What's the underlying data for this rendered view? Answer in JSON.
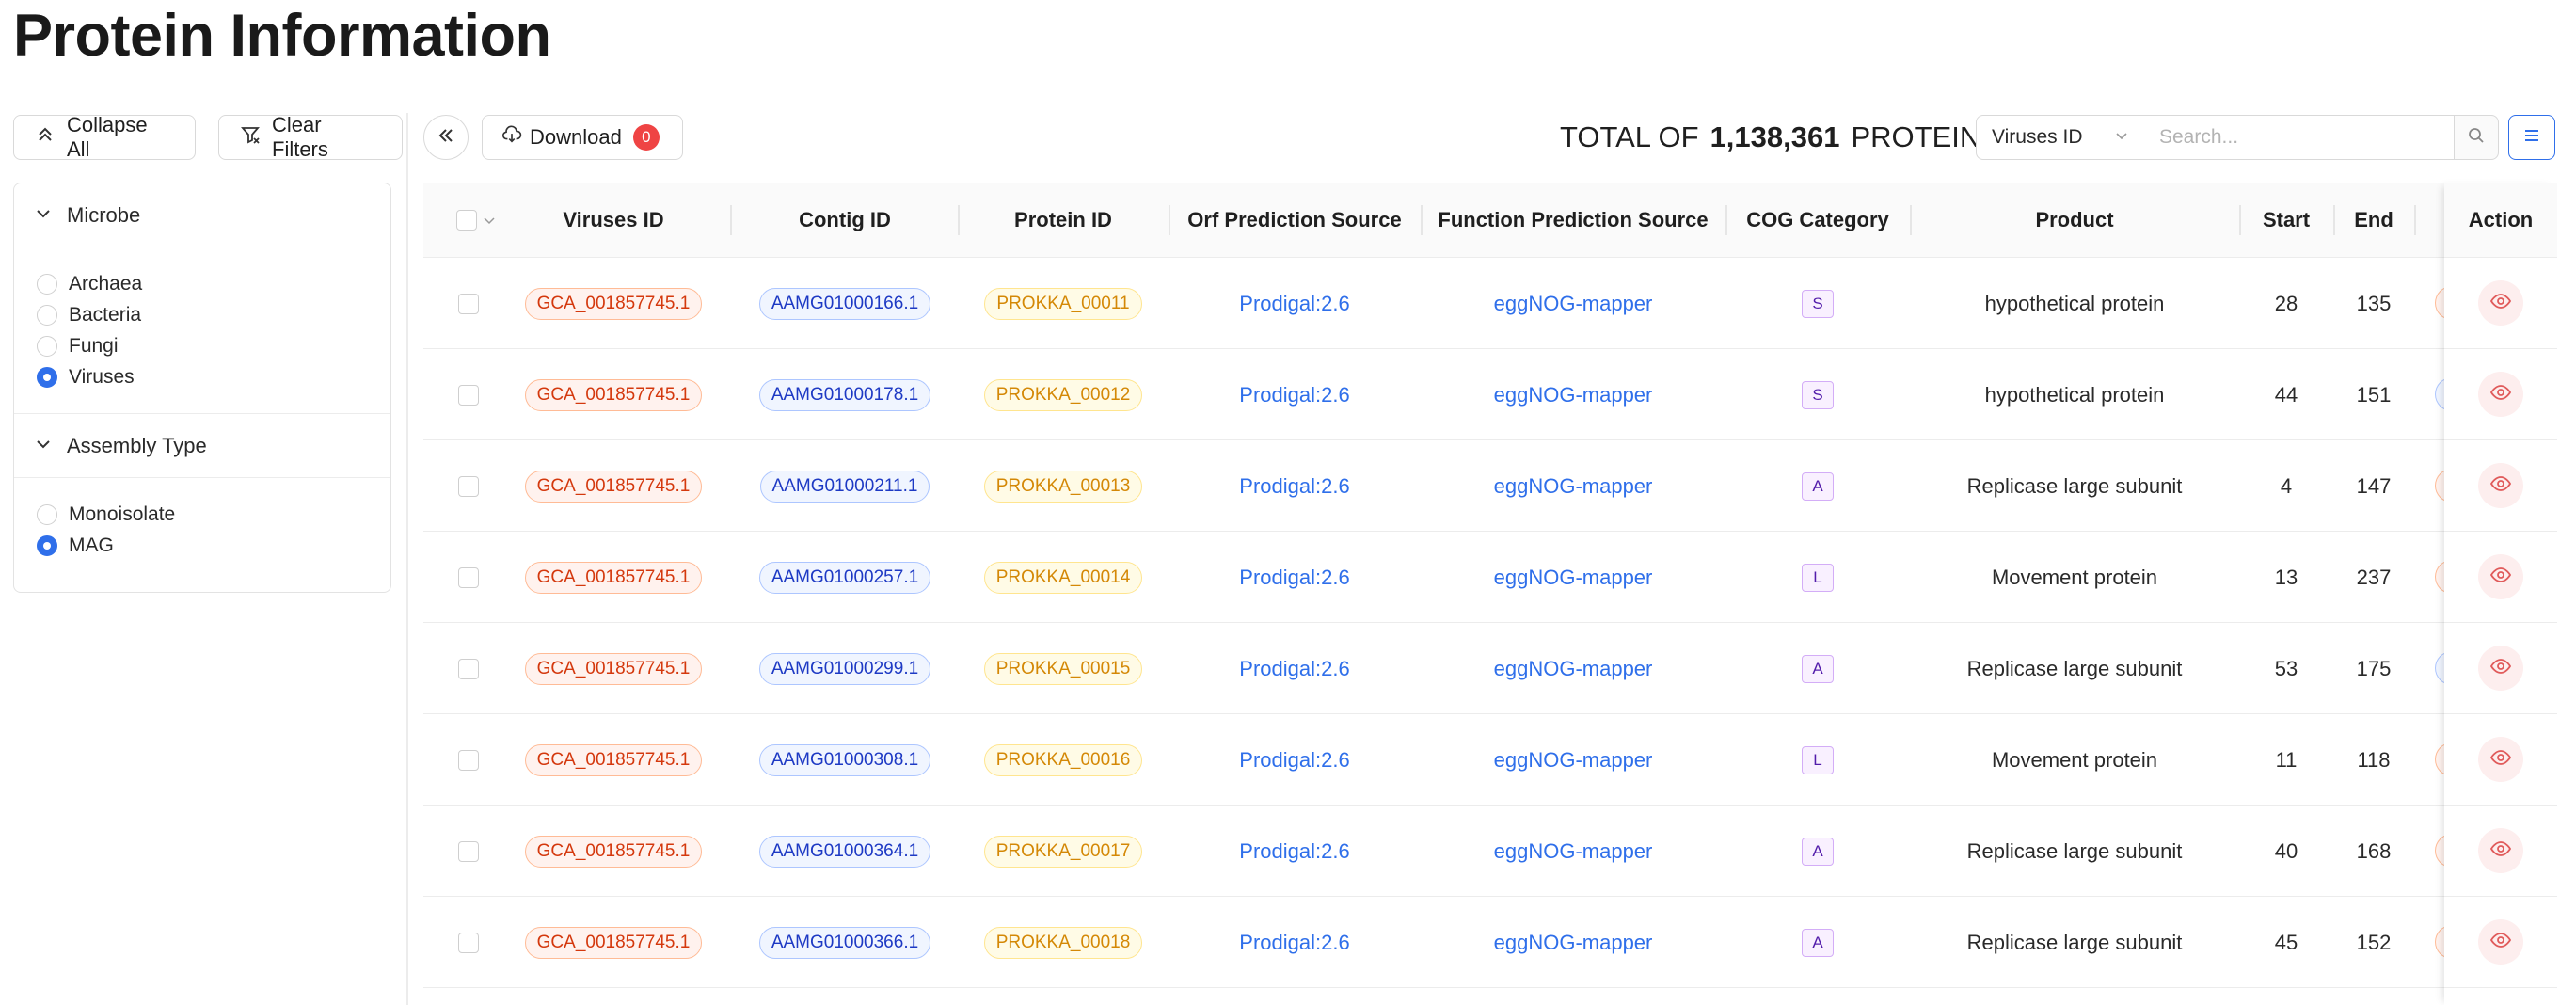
{
  "page_title": "Protein Information",
  "sidebar": {
    "collapse_all_label": "Collapse All",
    "clear_filters_label": "Clear Filters",
    "sections": [
      {
        "title": "Microbe",
        "options": [
          {
            "label": "Archaea",
            "selected": false
          },
          {
            "label": "Bacteria",
            "selected": false
          },
          {
            "label": "Fungi",
            "selected": false
          },
          {
            "label": "Viruses",
            "selected": true
          }
        ]
      },
      {
        "title": "Assembly Type",
        "options": [
          {
            "label": "Monoisolate",
            "selected": false
          },
          {
            "label": "MAG",
            "selected": true
          }
        ]
      }
    ]
  },
  "toolbar": {
    "download_label": "Download",
    "download_count": "0",
    "total_prefix": "TOTAL OF",
    "total_count": "1,138,361",
    "total_suffix": "PROTEIN",
    "search_field": "Viruses ID",
    "search_placeholder": "Search..."
  },
  "table": {
    "columns": [
      "Viruses ID",
      "Contig ID",
      "Protein ID",
      "Orf Prediction Source",
      "Function Prediction Source",
      "COG Category",
      "Product",
      "Start",
      "End",
      "Action"
    ],
    "rows": [
      {
        "viruses_id": "GCA_001857745.1",
        "contig_id": "AAMG01000166.1",
        "protein_id": "PROKKA_00011",
        "orf": "Prodigal:2.6",
        "func": "eggNOG-mapper",
        "cog": "S",
        "product": "hypothetical protein",
        "start": "28",
        "end": "135",
        "cut": "red"
      },
      {
        "viruses_id": "GCA_001857745.1",
        "contig_id": "AAMG01000178.1",
        "protein_id": "PROKKA_00012",
        "orf": "Prodigal:2.6",
        "func": "eggNOG-mapper",
        "cog": "S",
        "product": "hypothetical protein",
        "start": "44",
        "end": "151",
        "cut": "blue"
      },
      {
        "viruses_id": "GCA_001857745.1",
        "contig_id": "AAMG01000211.1",
        "protein_id": "PROKKA_00013",
        "orf": "Prodigal:2.6",
        "func": "eggNOG-mapper",
        "cog": "A",
        "product": "Replicase large subunit",
        "start": "4",
        "end": "147",
        "cut": "red"
      },
      {
        "viruses_id": "GCA_001857745.1",
        "contig_id": "AAMG01000257.1",
        "protein_id": "PROKKA_00014",
        "orf": "Prodigal:2.6",
        "func": "eggNOG-mapper",
        "cog": "L",
        "product": "Movement protein",
        "start": "13",
        "end": "237",
        "cut": "red"
      },
      {
        "viruses_id": "GCA_001857745.1",
        "contig_id": "AAMG01000299.1",
        "protein_id": "PROKKA_00015",
        "orf": "Prodigal:2.6",
        "func": "eggNOG-mapper",
        "cog": "A",
        "product": "Replicase large subunit",
        "start": "53",
        "end": "175",
        "cut": "blue"
      },
      {
        "viruses_id": "GCA_001857745.1",
        "contig_id": "AAMG01000308.1",
        "protein_id": "PROKKA_00016",
        "orf": "Prodigal:2.6",
        "func": "eggNOG-mapper",
        "cog": "L",
        "product": "Movement protein",
        "start": "11",
        "end": "118",
        "cut": "red"
      },
      {
        "viruses_id": "GCA_001857745.1",
        "contig_id": "AAMG01000364.1",
        "protein_id": "PROKKA_00017",
        "orf": "Prodigal:2.6",
        "func": "eggNOG-mapper",
        "cog": "A",
        "product": "Replicase large subunit",
        "start": "40",
        "end": "168",
        "cut": "red"
      },
      {
        "viruses_id": "GCA_001857745.1",
        "contig_id": "AAMG01000366.1",
        "protein_id": "PROKKA_00018",
        "orf": "Prodigal:2.6",
        "func": "eggNOG-mapper",
        "cog": "A",
        "product": "Replicase large subunit",
        "start": "45",
        "end": "152",
        "cut": "red"
      }
    ]
  },
  "colors": {
    "accent": "#2f6fea",
    "badge": "#ef4444",
    "action_bg": "#fdeeee",
    "action_icon": "#e05a5a"
  },
  "icons": [
    "collapse-icon",
    "filter-icon",
    "chevron-down-icon",
    "double-chevron-left-icon",
    "cloud-download-icon",
    "search-icon",
    "menu-icon",
    "eye-icon"
  ]
}
